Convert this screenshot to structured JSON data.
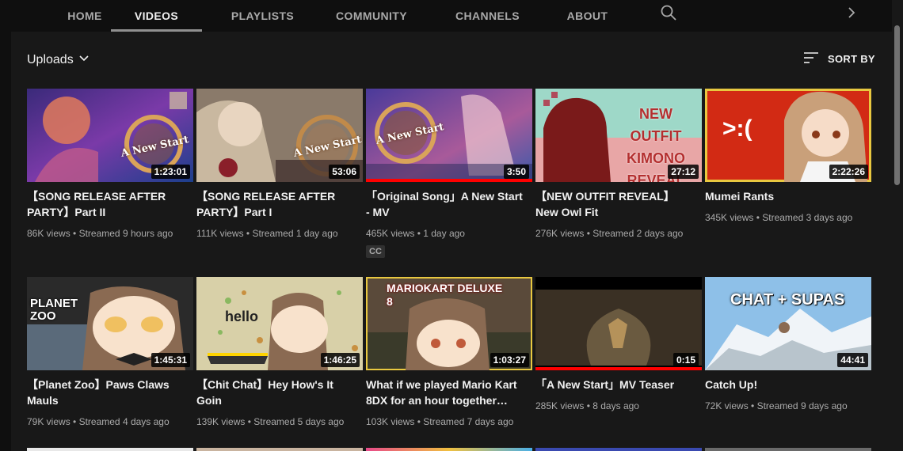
{
  "tabs": [
    {
      "label": "HOME"
    },
    {
      "label": "VIDEOS"
    },
    {
      "label": "PLAYLISTS"
    },
    {
      "label": "COMMUNITY"
    },
    {
      "label": "CHANNELS"
    },
    {
      "label": "ABOUT"
    }
  ],
  "active_tab": "VIDEOS",
  "icons": {
    "search": "search-icon",
    "next": "chevron-right-icon",
    "dropdown": "chevron-down-icon",
    "sort": "sort-icon"
  },
  "filter": {
    "label": "Uploads"
  },
  "sort": {
    "label": "SORT BY"
  },
  "colors": {
    "background": "#0f0f0f",
    "panel": "#181818",
    "progress": "#ff0000",
    "text": "#f1f1f1",
    "muted": "#aaaaaa"
  },
  "videos": [
    {
      "title": "【SONG RELEASE AFTER PARTY】Part II",
      "duration": "1:23:01",
      "views": "86K views",
      "age": "Streamed 9 hours ago",
      "thumb_text": "A New Start"
    },
    {
      "title": "【SONG RELEASE AFTER PARTY】Part I",
      "duration": "53:06",
      "views": "111K views",
      "age": "Streamed 1 day ago",
      "thumb_text": "A New Start"
    },
    {
      "title": "「Original Song」A New Start - MV",
      "duration": "3:50",
      "views": "465K views",
      "age": "1 day ago",
      "badge": "CC",
      "watched": 1.0,
      "thumb_text": "A New Start"
    },
    {
      "title": "【NEW OUTFIT REVEAL】New Owl Fit",
      "duration": "27:12",
      "views": "276K views",
      "age": "Streamed 2 days ago",
      "thumb_text": "NEW OUTFIT KIMONO REVEAL"
    },
    {
      "title": "Mumei Rants",
      "duration": "2:22:26",
      "views": "345K views",
      "age": "Streamed 3 days ago",
      "thumb_text": ">:("
    },
    {
      "title": "【Planet Zoo】Paws Claws Mauls",
      "duration": "1:45:31",
      "views": "79K views",
      "age": "Streamed 4 days ago",
      "thumb_text": "PLANET ZOO"
    },
    {
      "title": "【Chit Chat】Hey How's It Goin",
      "duration": "1:46:25",
      "views": "139K views",
      "age": "Streamed 5 days ago",
      "thumb_text": "hello"
    },
    {
      "title": "What if we played Mario Kart 8DX for an hour together…",
      "duration": "1:03:27",
      "views": "103K views",
      "age": "Streamed 7 days ago",
      "thumb_text": "MARIOKART DELUXE 8"
    },
    {
      "title": "「A New Start」MV Teaser",
      "duration": "0:15",
      "views": "285K views",
      "age": "8 days ago",
      "watched": 1.0,
      "thumb_text": ""
    },
    {
      "title": "Catch Up!",
      "duration": "44:41",
      "views": "72K views",
      "age": "Streamed 9 days ago",
      "thumb_text": "CHAT + SUPAS"
    }
  ]
}
